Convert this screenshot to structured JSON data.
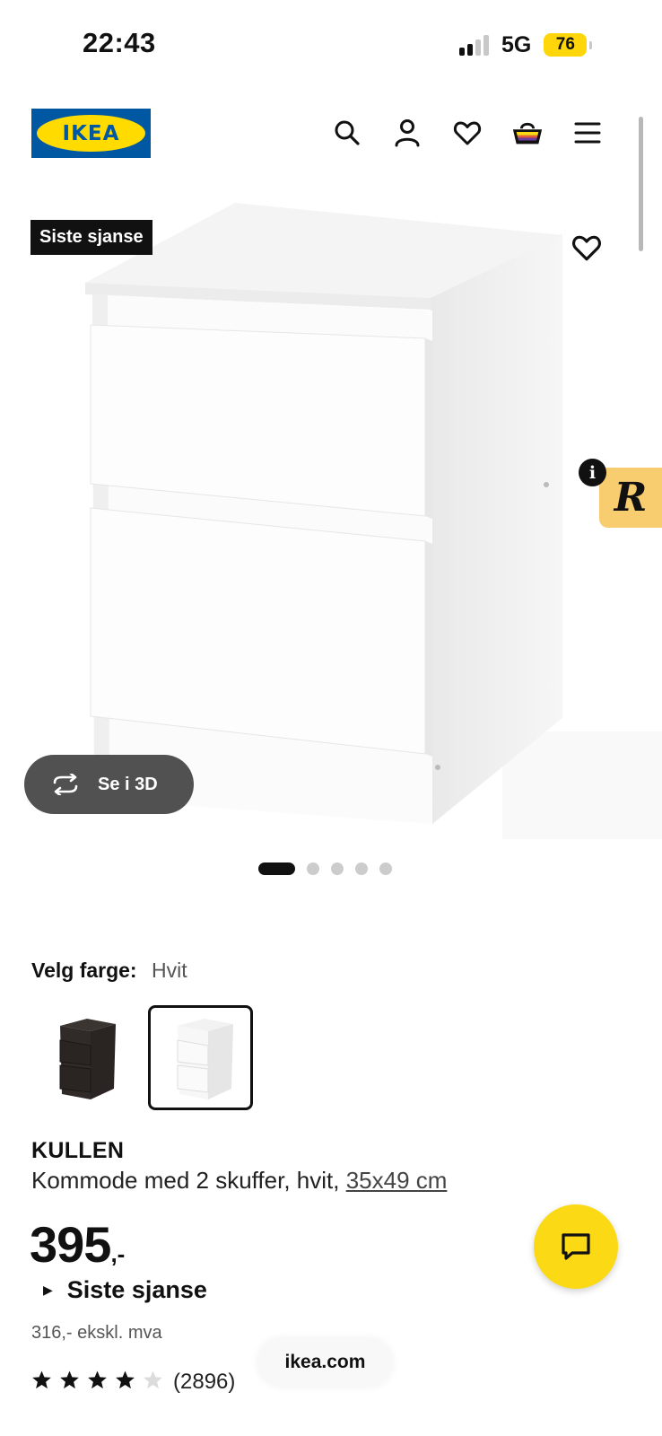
{
  "status_bar": {
    "time": "22:43",
    "network": "5G",
    "battery": "76"
  },
  "header": {
    "logo_text": "IKEA",
    "icons": [
      "search-icon",
      "account-icon",
      "favorites-icon",
      "cart-icon",
      "menu-icon"
    ]
  },
  "gallery": {
    "badge": "Siste sjanse",
    "view_3d_label": "Se i 3D",
    "image_count": 5,
    "active_image": 1
  },
  "color_selector": {
    "label": "Velg farge:",
    "selected_value": "Hvit",
    "options": [
      "black-brown",
      "white"
    ]
  },
  "product": {
    "name": "KULLEN",
    "description": "Kommode med 2 skuffer, hvit, ",
    "dimensions": "35x49 cm",
    "price": "395",
    "price_suffix": ",-",
    "promo_label": "Siste sjanse",
    "price_ex_vat": "316,- ekskl. mva",
    "rating": 4,
    "rating_max": 5,
    "review_count": "(2896)"
  },
  "browser": {
    "url": "ikea.com"
  },
  "colors": {
    "ikea_blue": "#0058a3",
    "ikea_yellow": "#ffdb00",
    "chat_yellow": "#fbd914"
  }
}
